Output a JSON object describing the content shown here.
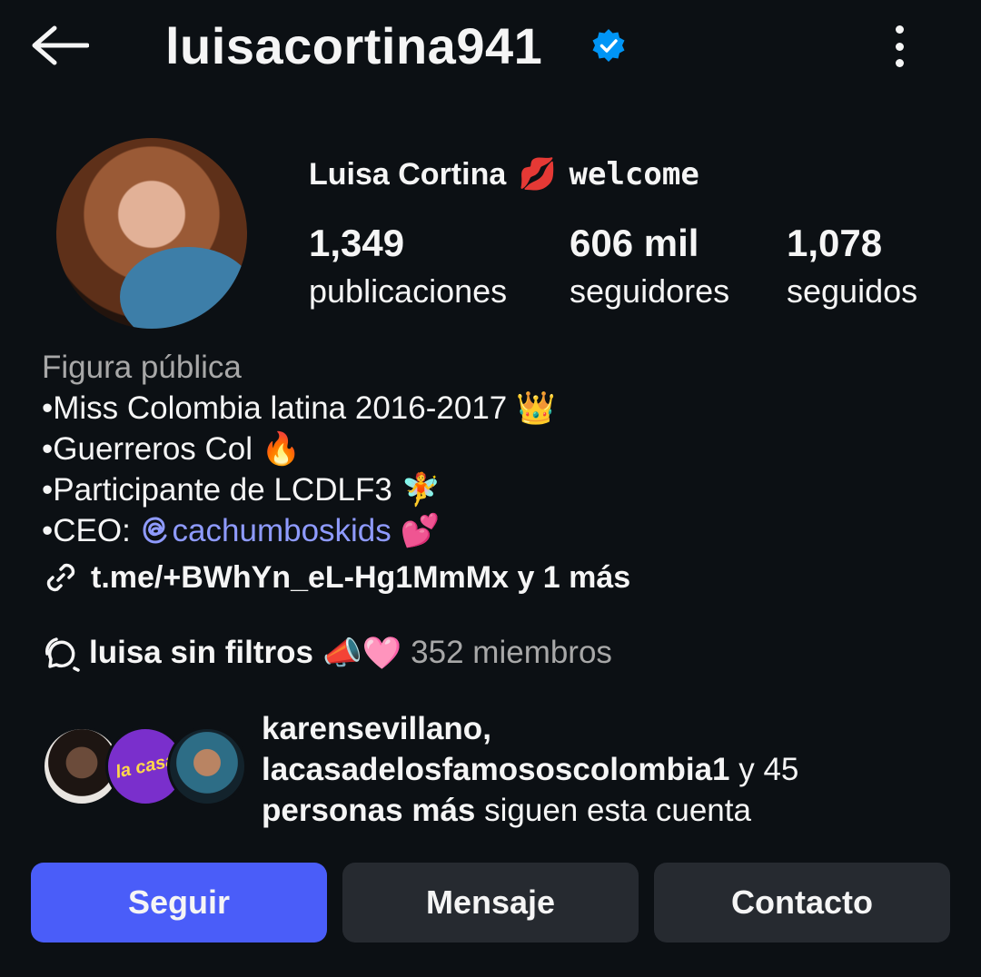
{
  "header": {
    "username": "luisacortina941",
    "verified_color": "#0095f6"
  },
  "profile": {
    "display_name": "Luisa Cortina",
    "display_name_suffix": "welcome",
    "stats": {
      "posts_count": "1,349",
      "posts_label": "publicaciones",
      "followers_count": "606 mil",
      "followers_label": "seguidores",
      "following_count": "1,078",
      "following_label": "seguidos"
    }
  },
  "bio": {
    "category": "Figura pública",
    "lines": [
      "•Miss Colombia latina 2016-2017 👑",
      "•Guerreros Col 🔥",
      "•Participante de LCDLF3 🧚"
    ],
    "ceo_prefix": "•CEO: ",
    "ceo_mention": "cachumboskids",
    "ceo_emoji": "💕",
    "link": "t.me/+BWhYn_eL-Hg1MmMx y 1 más"
  },
  "channel": {
    "name": "luisa sin filtros",
    "emoji": "📣🩷",
    "members": "352 miembros"
  },
  "mutual": {
    "names_line1": "karensevillano,",
    "names_line2": "lacasadelosfamososcolombia1",
    "joiner": " y 45",
    "bold_tail": "personas más",
    "tail": " siguen esta cuenta",
    "avatar2_text": "la casa"
  },
  "buttons": {
    "follow": "Seguir",
    "message": "Mensaje",
    "contact": "Contacto"
  },
  "colors": {
    "background": "#0c1014",
    "primary_button": "#4a5df9",
    "secondary_button": "#262a30",
    "mention": "#8f9bff",
    "muted_text": "#a8a8a8"
  }
}
